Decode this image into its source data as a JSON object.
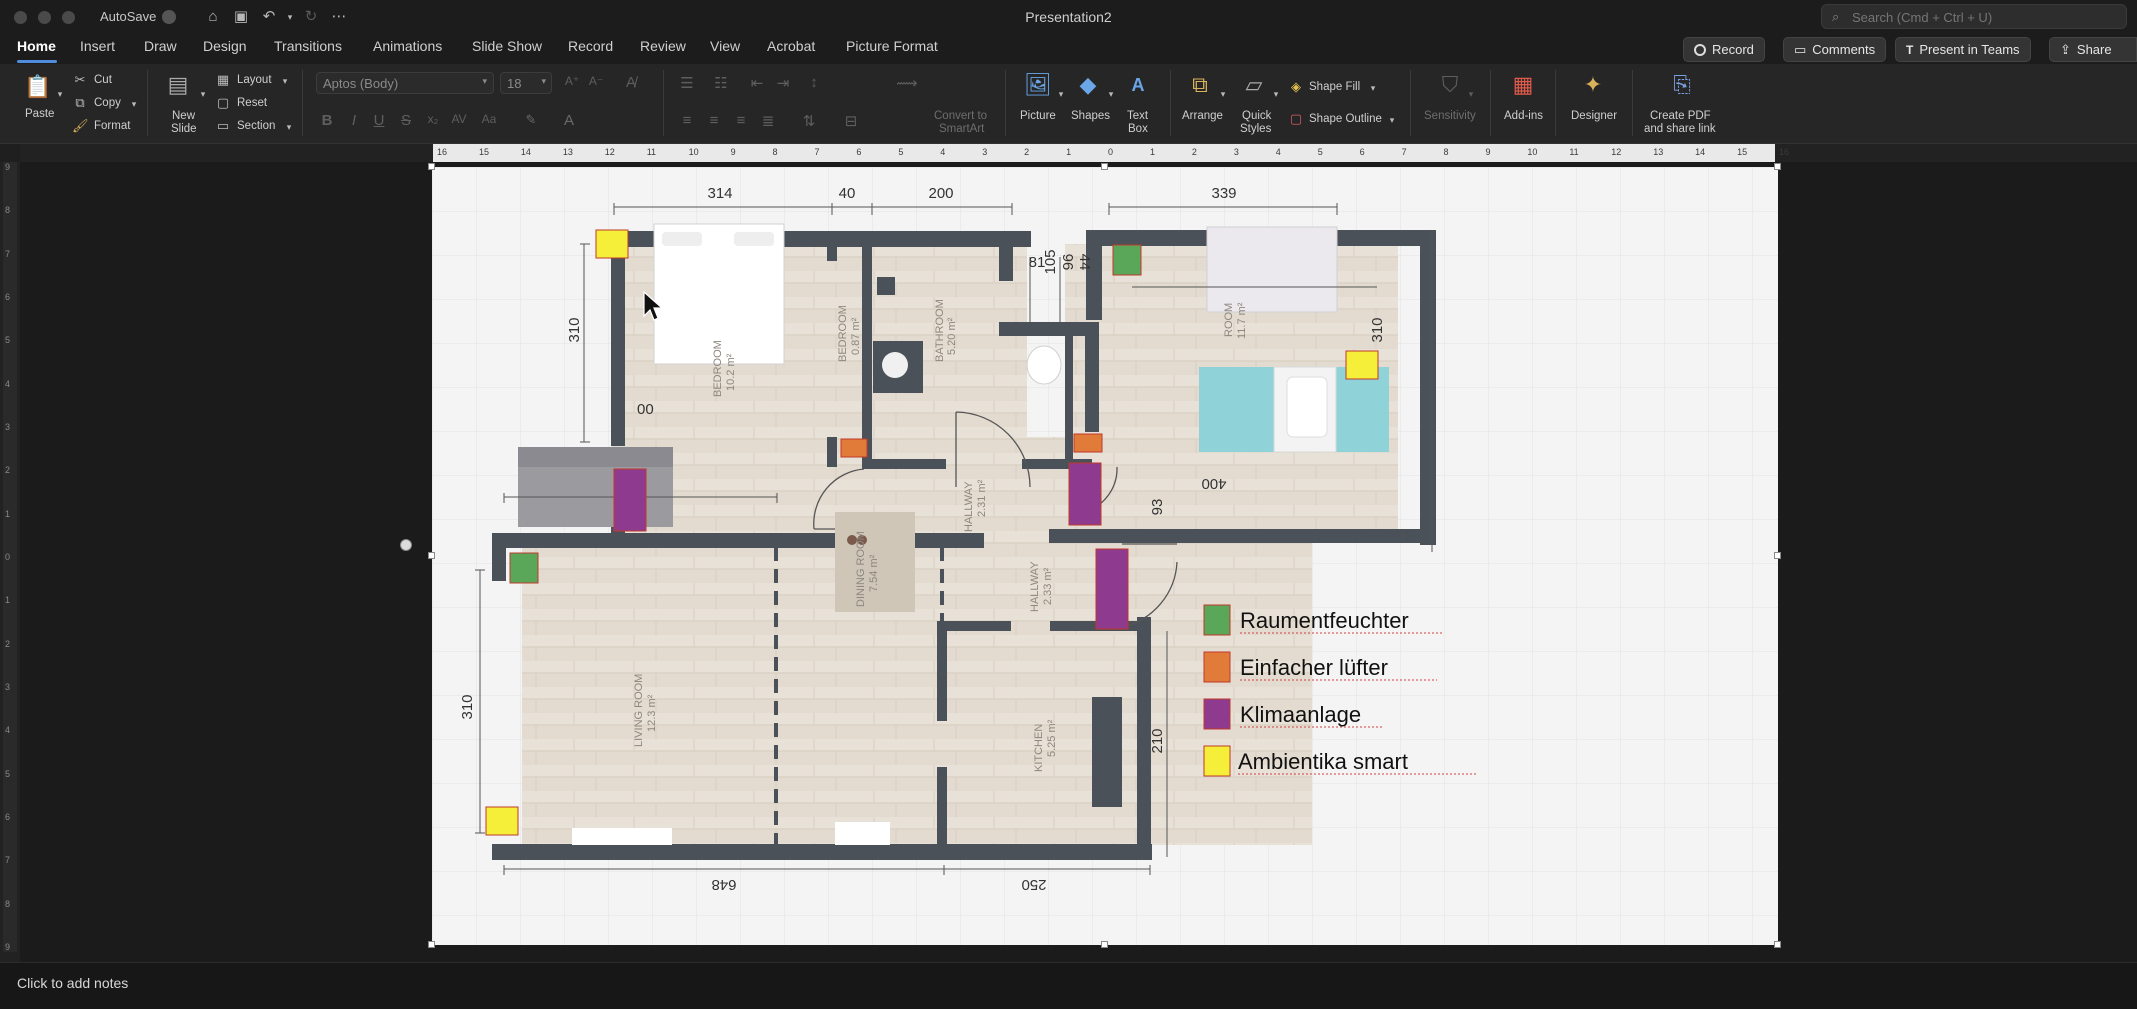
{
  "window": {
    "autosave_label": "AutoSave",
    "doc_title": "Presentation2",
    "search_placeholder": "Search (Cmd + Ctrl + U)"
  },
  "tabs": [
    "Home",
    "Insert",
    "Draw",
    "Design",
    "Transitions",
    "Animations",
    "Slide Show",
    "Record",
    "Review",
    "View",
    "Acrobat",
    "Picture Format"
  ],
  "active_tab": "Home",
  "actions": {
    "record": "Record",
    "comments": "Comments",
    "present_in_teams": "Present in Teams",
    "share": "Share"
  },
  "ribbon": {
    "paste": "Paste",
    "cut": "Cut",
    "copy": "Copy",
    "format": "Format",
    "new_slide_1": "New",
    "new_slide_2": "Slide",
    "layout": "Layout",
    "reset": "Reset",
    "section": "Section",
    "font_name": "Aptos (Body)",
    "font_size": "18",
    "convert_1": "Convert to",
    "convert_2": "SmartArt",
    "picture": "Picture",
    "shapes": "Shapes",
    "text_box_1": "Text",
    "text_box_2": "Box",
    "arrange": "Arrange",
    "quick_styles_1": "Quick",
    "quick_styles_2": "Styles",
    "shape_fill": "Shape Fill",
    "shape_outline": "Shape Outline",
    "sensitivity": "Sensitivity",
    "add_ins": "Add-ins",
    "designer": "Designer",
    "create_pdf_1": "Create PDF",
    "create_pdf_2": "and share link"
  },
  "ruler": {
    "top": [
      "16",
      "15",
      "14",
      "13",
      "12",
      "11",
      "10",
      "9",
      "8",
      "7",
      "6",
      "5",
      "4",
      "3",
      "2",
      "1",
      "0",
      "1",
      "2",
      "3",
      "4",
      "5",
      "6",
      "7",
      "8",
      "9",
      "10",
      "11",
      "12",
      "13",
      "14",
      "15",
      "16"
    ],
    "left": [
      "9",
      "8",
      "7",
      "6",
      "5",
      "4",
      "3",
      "2",
      "1",
      "0",
      "1",
      "2",
      "3",
      "4",
      "5",
      "6",
      "7",
      "8",
      "9"
    ]
  },
  "floorplan": {
    "dimensions": {
      "d314": "314",
      "d40": "40",
      "d200": "200",
      "d339": "339",
      "d81": "81",
      "d105": "105",
      "d44": "44",
      "d96": "96",
      "d310_left": "310",
      "d310_right": "310",
      "d310_lower": "310",
      "d00": "00",
      "d400": "400",
      "d93": "93",
      "d210": "210",
      "d648": "648",
      "d250": "250"
    },
    "rooms": {
      "bedroom_main": "BEDROOM",
      "bedroom_main_area": "10.2 m²",
      "bedroom_small": "BEDROOM",
      "bedroom_small_area": "0.87 m²",
      "bathroom": "BATHROOM",
      "bathroom_area": "5.20 m²",
      "room": "ROOM",
      "room_area": "11.7 m²",
      "hallway1": "HALLWAY",
      "hallway1_area": "2.31 m²",
      "hallway2": "HALLWAY",
      "hallway2_area": "2.33 m²",
      "living": "LIVING ROOM",
      "living_area": "12.3 m²",
      "dining": "DINING ROOM",
      "dining_area": "7.54 m²",
      "kitchen": "KITCHEN",
      "kitchen_area": "5.25 m²"
    }
  },
  "legend": [
    {
      "label": "Raumentfeuchter",
      "color": "#5aa75a"
    },
    {
      "label": "Einfacher lüfter",
      "color": "#e07b39"
    },
    {
      "label": "Klimaanlage",
      "color": "#8e3a8e"
    },
    {
      "label": "Ambientika smart",
      "color": "#f6ef3a"
    }
  ],
  "notes": {
    "placeholder": "Click to add notes"
  }
}
